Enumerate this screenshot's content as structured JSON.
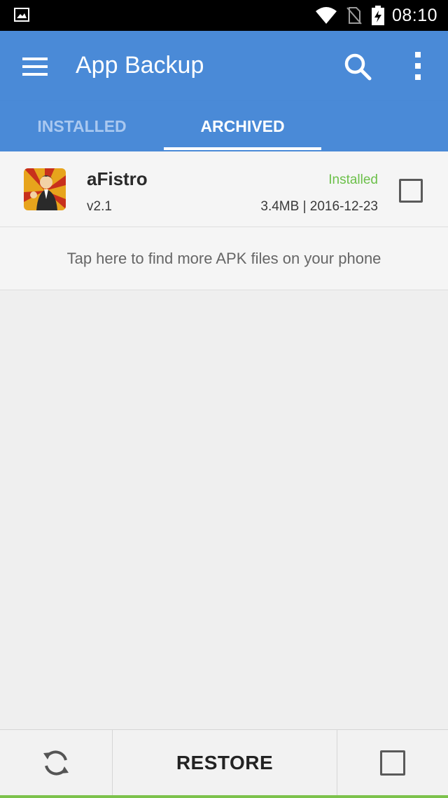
{
  "status_bar": {
    "time": "08:10",
    "icons": [
      "image-notification-icon",
      "wifi-icon",
      "no-sim-icon",
      "battery-charging-icon"
    ]
  },
  "app_bar": {
    "title": "App Backup",
    "icons": [
      "menu-icon",
      "search-icon",
      "more-vert-icon"
    ]
  },
  "tabs": [
    {
      "label": "INSTALLED",
      "selected": false
    },
    {
      "label": "ARCHIVED",
      "selected": true
    }
  ],
  "apps": [
    {
      "name": "aFistro",
      "version": "v2.1",
      "status": "Installed",
      "meta": "3.4MB | 2016-12-23",
      "checked": false
    }
  ],
  "find_more": "Tap here to find more APK files on your phone",
  "bottom_bar": {
    "restore_label": "RESTORE",
    "icons": [
      "refresh-icon",
      "select-all-checkbox"
    ]
  },
  "colors": {
    "primary": "#4a8ad7",
    "status_installed": "#6cc04a",
    "accent_bottom": "#7cc24c"
  }
}
